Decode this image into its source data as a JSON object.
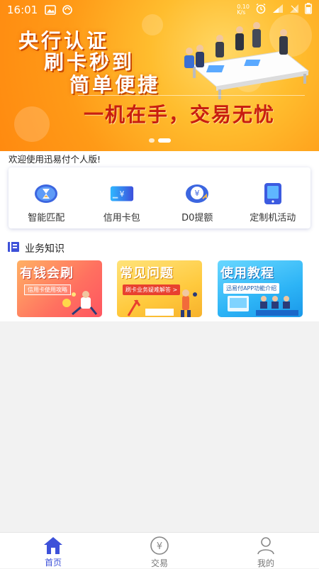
{
  "status_bar": {
    "time": "16:01",
    "network_text": "0.10\nK/s"
  },
  "banner": {
    "line1": "央行认证",
    "line2": "刷卡秒到",
    "line3": "简单便捷",
    "slogan": "一机在手，交易无忧",
    "page_count": 2,
    "active_page": 1
  },
  "welcome": {
    "text": "欢迎使用迅易付个人版!"
  },
  "features": [
    {
      "label": "智能匹配",
      "icon": "hourglass-icon"
    },
    {
      "label": "信用卡包",
      "icon": "credit-card-icon"
    },
    {
      "label": "D0提额",
      "icon": "money-up-icon"
    },
    {
      "label": "定制机活动",
      "icon": "tablet-icon"
    }
  ],
  "knowledge": {
    "title": "业务知识",
    "cards": [
      {
        "title": "有钱会刷",
        "subtitle": "信用卡使用攻略"
      },
      {
        "title": "常见问题",
        "subtitle": "刷卡业务疑难解答 >"
      },
      {
        "title": "使用教程",
        "subtitle": "迅易付APP功能介绍"
      }
    ]
  },
  "nav": {
    "items": [
      {
        "label": "首页",
        "icon": "home-icon",
        "active": true
      },
      {
        "label": "交易",
        "icon": "yuan-circle-icon",
        "active": false
      },
      {
        "label": "我的",
        "icon": "user-icon",
        "active": false
      }
    ]
  },
  "colors": {
    "accent": "#3d51d9",
    "banner_orange": "#ff9a17",
    "slogan_red": "#c81e10"
  }
}
